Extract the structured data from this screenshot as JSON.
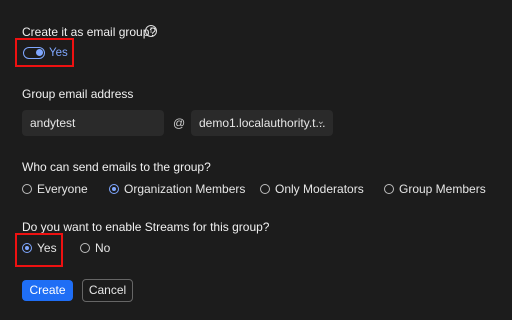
{
  "email_group": {
    "question": "Create it as email group?",
    "toggle_label": "Yes"
  },
  "group_email": {
    "label": "Group email address",
    "local_value": "andytest",
    "at_symbol": "@",
    "domain_value": "demo1.localauthority.t..."
  },
  "send_permission": {
    "question": "Who can send emails to the group?",
    "options": [
      "Everyone",
      "Organization Members",
      "Only Moderators",
      "Group Members"
    ],
    "selected": "Organization Members"
  },
  "streams": {
    "question": "Do you want to enable Streams for this group?",
    "options": [
      "Yes",
      "No"
    ],
    "selected": "Yes"
  },
  "actions": {
    "create_label": "Create",
    "cancel_label": "Cancel"
  },
  "icons": {
    "info": "info-icon",
    "chevron": "chevron-down-icon"
  },
  "colors": {
    "accent": "#7fa7ff",
    "primary_button": "#1f6ef5",
    "highlight_box": "#e11111"
  }
}
